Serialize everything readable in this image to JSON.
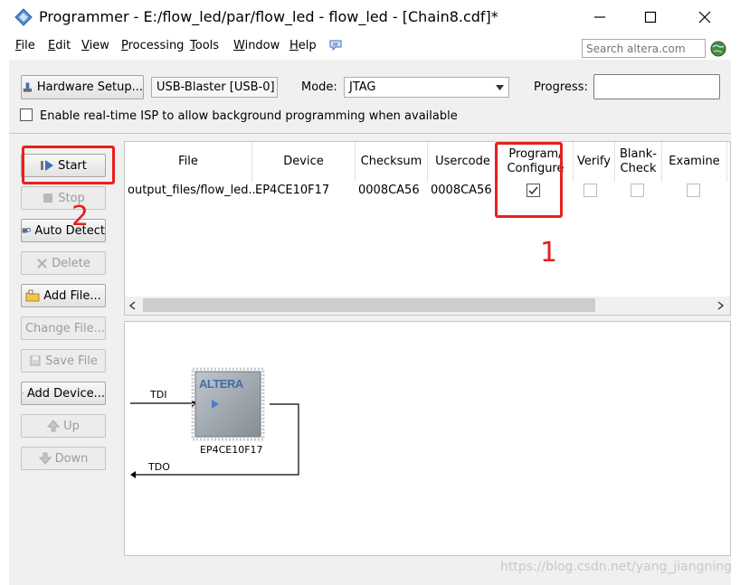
{
  "window": {
    "title": "Programmer - E:/flow_led/par/flow_led - flow_led - [Chain8.cdf]*",
    "controls": {
      "minimize": "—",
      "maximize": "☐",
      "close": "✕"
    }
  },
  "menu": {
    "items": [
      {
        "mnemonic": "F",
        "rest": "ile"
      },
      {
        "mnemonic": "E",
        "rest": "dit"
      },
      {
        "mnemonic": "V",
        "rest": "iew"
      },
      {
        "mnemonic": "P",
        "rest": "rocessing"
      },
      {
        "mnemonic": "T",
        "rest": "ools"
      },
      {
        "mnemonic": "W",
        "rest": "indow"
      },
      {
        "mnemonic": "H",
        "rest": "elp"
      }
    ],
    "search_placeholder": "Search altera.com"
  },
  "toolbar": {
    "hardware_button": "Hardware Setup...",
    "hardware_value": "USB-Blaster [USB-0]",
    "mode_label": "Mode:",
    "mode_value": "JTAG",
    "progress_label": "Progress:",
    "progress_value": "",
    "isp_label": "Enable real-time ISP to allow background programming when available"
  },
  "side_buttons": [
    {
      "label": "Start",
      "enabled": true,
      "icon": "start-icon"
    },
    {
      "label": "Stop",
      "enabled": false,
      "icon": "stop-icon"
    },
    {
      "label": "Auto Detect",
      "enabled": true,
      "icon": "auto-detect-icon"
    },
    {
      "label": "Delete",
      "enabled": false,
      "icon": "delete-icon"
    },
    {
      "label": "Add File...",
      "enabled": true,
      "icon": "add-file-icon"
    },
    {
      "label": "Change File...",
      "enabled": false,
      "icon": "change-file-icon"
    },
    {
      "label": "Save File",
      "enabled": false,
      "icon": "save-file-icon"
    },
    {
      "label": "Add Device...",
      "enabled": true,
      "icon": "add-device-icon"
    },
    {
      "label": "Up",
      "enabled": false,
      "icon": "up-icon"
    },
    {
      "label": "Down",
      "enabled": false,
      "icon": "down-icon"
    }
  ],
  "table": {
    "columns": [
      "File",
      "Device",
      "Checksum",
      "Usercode",
      "Program/\nConfigure",
      "Verify",
      "Blank-\nCheck",
      "Examine"
    ],
    "rows": [
      {
        "file": "output_files/flow_led...",
        "device": "EP4CE10F17",
        "checksum": "0008CA56",
        "usercode": "0008CA56",
        "program_configure": true,
        "verify": false,
        "blank_check": false,
        "examine": false
      }
    ]
  },
  "diagram": {
    "chip_logo": "ALTERA",
    "chip_label": "EP4CE10F17",
    "tdi_label": "TDI",
    "tdo_label": "TDO"
  },
  "annotations": {
    "mark_1": "1",
    "mark_2": "2"
  },
  "watermark": "https://blog.csdn.net/yang_jiangning",
  "colors": {
    "annotation": "#e8201e",
    "panel_bg": "#f0f0f0"
  }
}
